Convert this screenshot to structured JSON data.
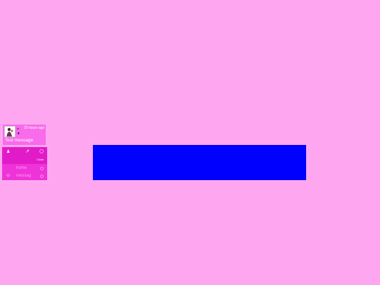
{
  "chat": {
    "sender_label": "hr",
    "timestamp": "20 hours ago",
    "message": "Test message",
    "avatar_icon": "user-photo"
  },
  "menu": {
    "close_label": "Close",
    "items": [
      {
        "label": "home",
        "icon": "home-icon"
      },
      {
        "label": "messag",
        "icon": "smiley-icon"
      }
    ]
  },
  "colors": {
    "background": "#fea7f0",
    "panel": "#0000fe",
    "card": "#f86bea",
    "menu": "#ee33d8"
  }
}
